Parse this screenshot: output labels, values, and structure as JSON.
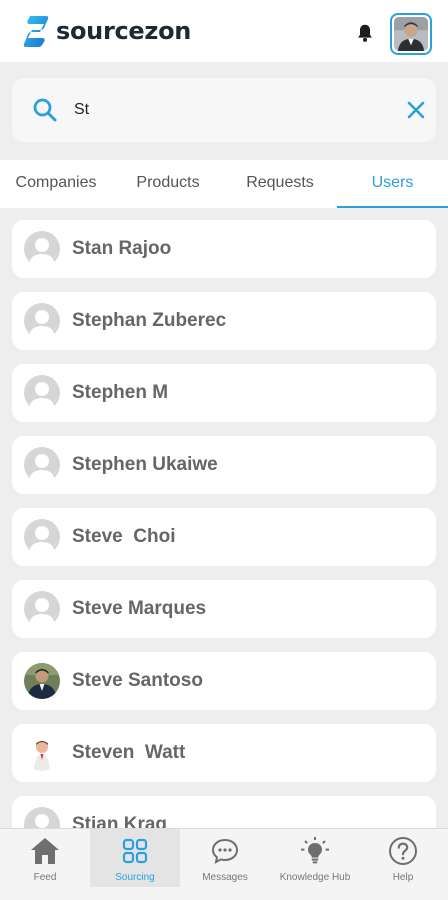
{
  "header": {
    "brand": "sourcezon",
    "logo_icon": "sourcezon-logo",
    "bell_icon": "bell-icon",
    "profile_icon": "profile-avatar"
  },
  "search": {
    "value": "St",
    "placeholder": "",
    "icon": "search-icon",
    "clear_icon": "close-icon"
  },
  "tabs": [
    {
      "label": "Companies",
      "active": false
    },
    {
      "label": "Products",
      "active": false
    },
    {
      "label": "Requests",
      "active": false
    },
    {
      "label": "Users",
      "active": true
    }
  ],
  "users": [
    {
      "name": "Stan Rajoo",
      "avatar": "placeholder"
    },
    {
      "name": "Stephan Zuberec",
      "avatar": "placeholder"
    },
    {
      "name": "Stephen M",
      "avatar": "placeholder"
    },
    {
      "name": "Stephen Ukaiwe",
      "avatar": "placeholder"
    },
    {
      "name": "Steve  Choi",
      "avatar": "placeholder"
    },
    {
      "name": "Steve Marques",
      "avatar": "placeholder"
    },
    {
      "name": "Steve Santoso",
      "avatar": "photo"
    },
    {
      "name": "Steven  Watt",
      "avatar": "photo"
    },
    {
      "name": "Stian Krag",
      "avatar": "placeholder"
    }
  ],
  "bottom_nav": [
    {
      "label": "Feed",
      "icon": "home-icon",
      "active": false
    },
    {
      "label": "Sourcing",
      "icon": "grid-icon",
      "active": true
    },
    {
      "label": "Messages",
      "icon": "chat-icon",
      "active": false
    },
    {
      "label": "Knowledge Hub",
      "icon": "lightbulb-icon",
      "active": false
    },
    {
      "label": "Help",
      "icon": "help-icon",
      "active": false
    }
  ],
  "colors": {
    "accent": "#2aa0dc",
    "background": "#eeeeee",
    "card": "#ffffff",
    "text_muted": "#666666"
  }
}
